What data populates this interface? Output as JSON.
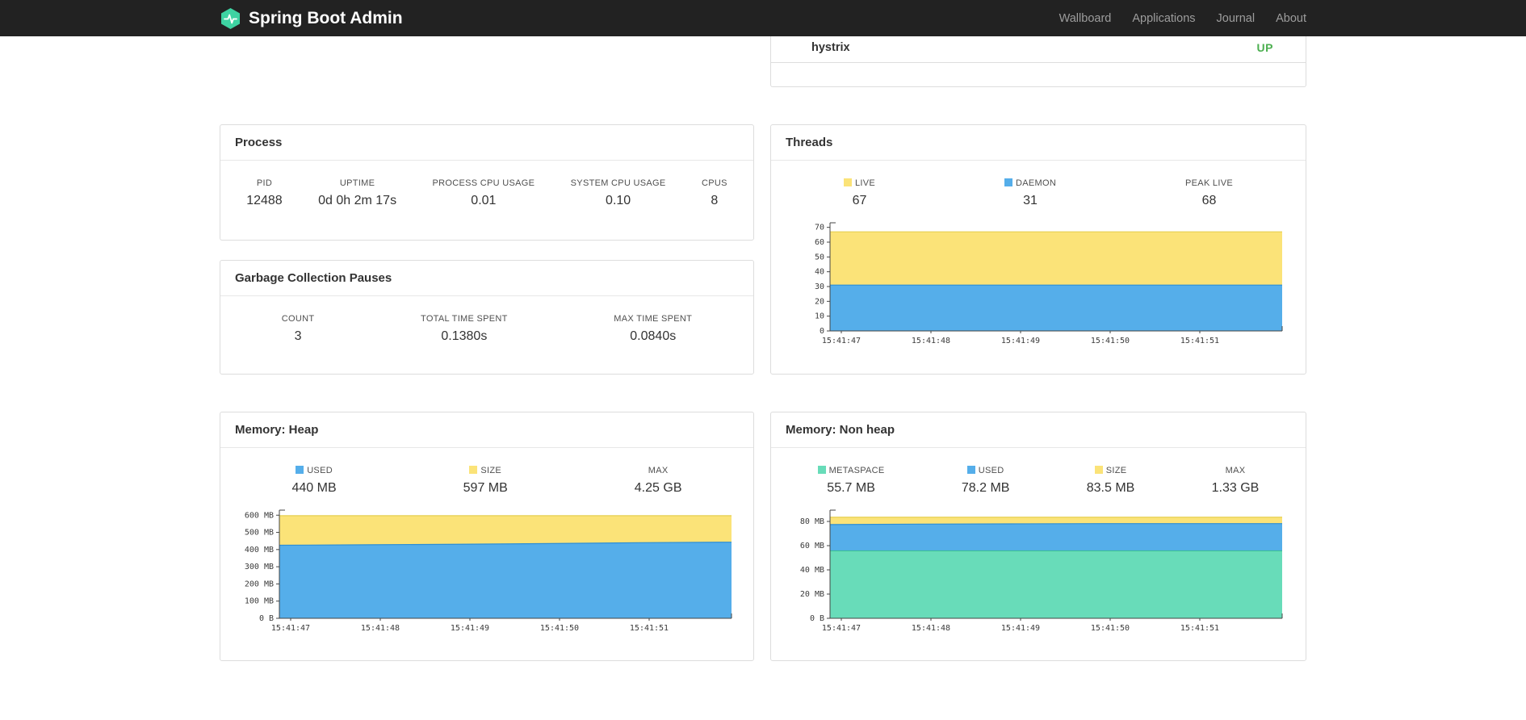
{
  "navbar": {
    "brand": "Spring Boot Admin",
    "links": [
      {
        "label": "Wallboard"
      },
      {
        "label": "Applications"
      },
      {
        "label": "Journal"
      },
      {
        "label": "About"
      }
    ]
  },
  "colors": {
    "brand": "#3ed3a2",
    "status_up": "#4caf50",
    "blue": "#55aeea",
    "yellow": "#fbe378",
    "green": "#68dcb9"
  },
  "applications_card": {
    "rows": [
      {
        "name": "hystrix",
        "status": "UP"
      }
    ]
  },
  "process_card": {
    "title": "Process",
    "stats": [
      {
        "label": "PID",
        "value": "12488"
      },
      {
        "label": "UPTIME",
        "value": "0d 0h 2m 17s"
      },
      {
        "label": "PROCESS CPU USAGE",
        "value": "0.01"
      },
      {
        "label": "SYSTEM CPU USAGE",
        "value": "0.10"
      },
      {
        "label": "CPUS",
        "value": "8"
      }
    ]
  },
  "gc_card": {
    "title": "Garbage Collection Pauses",
    "stats": [
      {
        "label": "COUNT",
        "value": "3"
      },
      {
        "label": "TOTAL TIME SPENT",
        "value": "0.1380s"
      },
      {
        "label": "MAX TIME SPENT",
        "value": "0.0840s"
      }
    ]
  },
  "threads_card": {
    "title": "Threads",
    "legend": [
      {
        "label": "LIVE",
        "value": "67"
      },
      {
        "label": "DAEMON",
        "value": "31"
      },
      {
        "label": "PEAK LIVE",
        "value": "68"
      }
    ]
  },
  "heap_card": {
    "title": "Memory: Heap",
    "legend": [
      {
        "label": "USED",
        "value": "440 MB"
      },
      {
        "label": "SIZE",
        "value": "597 MB"
      },
      {
        "label": "MAX",
        "value": "4.25 GB"
      }
    ]
  },
  "nonheap_card": {
    "title": "Memory: Non heap",
    "legend": [
      {
        "label": "METASPACE",
        "value": "55.7 MB"
      },
      {
        "label": "USED",
        "value": "78.2 MB"
      },
      {
        "label": "SIZE",
        "value": "83.5 MB"
      },
      {
        "label": "MAX",
        "value": "1.33 GB"
      }
    ]
  },
  "chart_data": [
    {
      "id": "threads",
      "type": "area",
      "stacked": true,
      "title": "Threads",
      "xticks": [
        "15:41:47",
        "15:41:48",
        "15:41:49",
        "15:41:50",
        "15:41:51"
      ],
      "ylim": [
        0,
        72
      ],
      "ymax": 72,
      "yticks": [
        {
          "v": 0,
          "label": "0"
        },
        {
          "v": 10,
          "label": "10"
        },
        {
          "v": 20,
          "label": "20"
        },
        {
          "v": 30,
          "label": "30"
        },
        {
          "v": 40,
          "label": "40"
        },
        {
          "v": 50,
          "label": "50"
        },
        {
          "v": 60,
          "label": "60"
        },
        {
          "v": 70,
          "label": "70"
        }
      ],
      "series": [
        {
          "name": "DAEMON",
          "color": "#55aeea",
          "line": "#2f8fd4",
          "values": [
            31,
            31,
            31,
            31,
            31,
            31
          ]
        },
        {
          "name": "LIVE",
          "color": "#fbe378",
          "line": "#e6cf52",
          "values": [
            67,
            67,
            67,
            67,
            67,
            67
          ]
        }
      ]
    },
    {
      "id": "memory-heap",
      "type": "area",
      "stacked": true,
      "title": "Memory: Heap",
      "xticks": [
        "15:41:47",
        "15:41:48",
        "15:41:49",
        "15:41:50",
        "15:41:51"
      ],
      "ylim": [
        0,
        620
      ],
      "ymax": 620,
      "yticks": [
        {
          "v": 0,
          "label": "0 B"
        },
        {
          "v": 100,
          "label": "100 MB"
        },
        {
          "v": 200,
          "label": "200 MB"
        },
        {
          "v": 300,
          "label": "300 MB"
        },
        {
          "v": 400,
          "label": "400 MB"
        },
        {
          "v": 500,
          "label": "500 MB"
        },
        {
          "v": 600,
          "label": "600 MB"
        }
      ],
      "series": [
        {
          "name": "USED",
          "color": "#55aeea",
          "line": "#2f8fd4",
          "values": [
            425,
            428,
            431,
            435,
            440,
            443
          ]
        },
        {
          "name": "SIZE",
          "color": "#fbe378",
          "line": "#e6cf52",
          "values": [
            597,
            597,
            597,
            597,
            597,
            597
          ]
        }
      ]
    },
    {
      "id": "memory-nonheap",
      "type": "area",
      "stacked": true,
      "title": "Memory: Non heap",
      "xticks": [
        "15:41:47",
        "15:41:48",
        "15:41:49",
        "15:41:50",
        "15:41:51"
      ],
      "ylim": [
        0,
        88
      ],
      "ymax": 88,
      "yticks": [
        {
          "v": 0,
          "label": "0 B"
        },
        {
          "v": 20,
          "label": "20 MB"
        },
        {
          "v": 40,
          "label": "40 MB"
        },
        {
          "v": 60,
          "label": "60 MB"
        },
        {
          "v": 80,
          "label": "80 MB"
        }
      ],
      "series": [
        {
          "name": "METASPACE",
          "color": "#68dcb9",
          "line": "#3cbf95",
          "values": [
            55.7,
            55.7,
            55.7,
            55.7,
            55.7,
            55.7
          ]
        },
        {
          "name": "USED",
          "color": "#55aeea",
          "line": "#2f8fd4",
          "values": [
            77.4,
            77.8,
            78,
            78.2,
            78.2,
            78.2
          ]
        },
        {
          "name": "SIZE",
          "color": "#fbe378",
          "line": "#e6cf52",
          "values": [
            83.5,
            83.5,
            83.5,
            83.5,
            83.5,
            83.5
          ]
        }
      ]
    }
  ]
}
